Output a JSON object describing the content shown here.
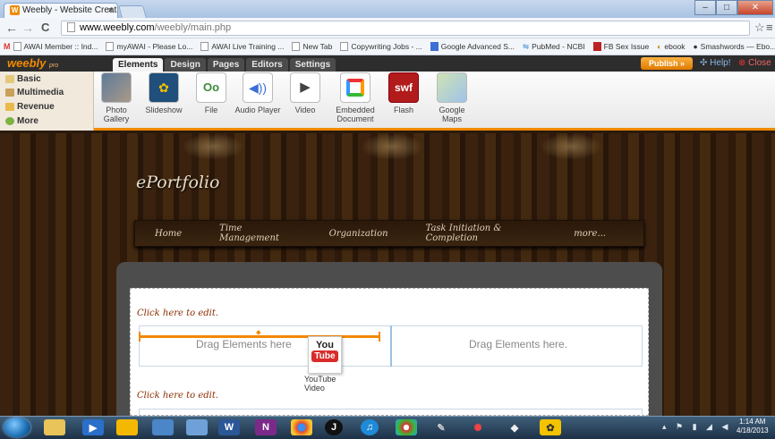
{
  "browser": {
    "tab_title": "Weebly - Website Creatio",
    "tab_favicon": "W",
    "tab_close": "×",
    "window_buttons": {
      "minimize": "–",
      "maximize": "□",
      "close": "✕"
    },
    "nav": {
      "back": "←",
      "forward": "→",
      "reload": "C"
    },
    "url_host": "www.weebly.com",
    "url_path": "/weebly/main.php",
    "star": "☆",
    "menu": "≡",
    "bookmarks": [
      "AWAI Member :: Ind...",
      "myAWAI - Please Lo...",
      "AWAI Live Training ...",
      "New Tab",
      "Copywriting Jobs - ...",
      "Google Advanced S...",
      "PubMed - NCBI",
      "FB Sex Issue",
      "ebook",
      "Smashwords — Ebo..."
    ],
    "bookmarks_more": "»"
  },
  "weebly": {
    "logo": "weebly",
    "logo_suffix": "pro",
    "top_tabs": [
      "Elements",
      "Design",
      "Pages",
      "Editors",
      "Settings"
    ],
    "active_tab": "Elements",
    "publish": "Publish »",
    "help": "Help!",
    "close": "Close",
    "categories": [
      "Basic",
      "Multimedia",
      "Revenue",
      "More"
    ],
    "elements": [
      {
        "label": "Photo Gallery",
        "icon": "photo-gallery-icon"
      },
      {
        "label": "Slideshow",
        "icon": "slideshow-icon"
      },
      {
        "label": "File",
        "icon": "file-icon"
      },
      {
        "label": "Audio Player",
        "icon": "audio-player-icon"
      },
      {
        "label": "Video",
        "icon": "video-icon"
      },
      {
        "label": "Embedded Document",
        "icon": "embedded-document-icon"
      },
      {
        "label": "Flash",
        "icon": "flash-icon"
      },
      {
        "label": "Google Maps",
        "icon": "google-maps-icon"
      }
    ],
    "flash_text": "swf"
  },
  "site": {
    "title": "ePortfolio",
    "nav": [
      "Home",
      "Time Management",
      "Organization",
      "Task Initiation & Completion",
      "more..."
    ],
    "click_edit_1": "Click here to edit.",
    "click_edit_2": "Click here to edit.",
    "drop_left": "Drag Elements here",
    "drop_right": "Drag Elements here.",
    "drag_item": {
      "you": "You",
      "tube": "Tube",
      "label": "YouTube Video"
    }
  },
  "taskbar": {
    "time": "1:14 AM",
    "date": "4/18/2013"
  },
  "colors": {
    "accent": "#f18a00",
    "wood_dark": "#2e1a0b",
    "taskbar": "#1d3147"
  }
}
